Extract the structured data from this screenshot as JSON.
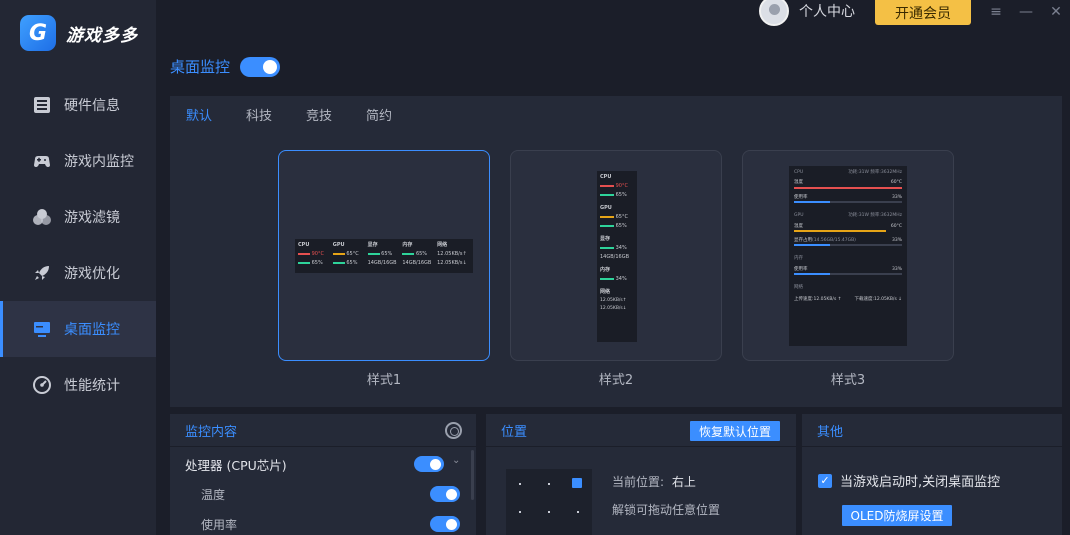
{
  "app": {
    "name": "游戏多多",
    "logo_letter": "G"
  },
  "topbar": {
    "user_label": "个人中心",
    "vip_button": "开通会员",
    "menu_icon": "≡",
    "min_icon": "—",
    "close_icon": "✕"
  },
  "sidebar": {
    "items": [
      {
        "label": "硬件信息",
        "icon": "hardware-icon"
      },
      {
        "label": "游戏内监控",
        "icon": "gamepad-icon"
      },
      {
        "label": "游戏滤镜",
        "icon": "filter-icon"
      },
      {
        "label": "游戏优化",
        "icon": "rocket-icon"
      },
      {
        "label": "桌面监控",
        "icon": "monitor-icon",
        "active": true
      },
      {
        "label": "性能统计",
        "icon": "gauge-icon"
      }
    ]
  },
  "desktop_monitor": {
    "title": "桌面监控",
    "enabled": true
  },
  "tabs": [
    "默认",
    "科技",
    "竞技",
    "简约"
  ],
  "active_tab": "默认",
  "styles": [
    {
      "label": "样式1",
      "selected": true
    },
    {
      "label": "样式2",
      "selected": false
    },
    {
      "label": "样式3",
      "selected": false
    }
  ],
  "preview1": {
    "cpu": "CPU",
    "gpu": "GPU",
    "vram": "显存",
    "mem": "内存",
    "net": "网络",
    "cpu_temp": "90°C",
    "gpu_temp": "65°C",
    "vram_pct": "65%",
    "mem_pct": "65%",
    "net_up": "12.05KB/s↑",
    "cpu_use": "65%",
    "gpu_use": "65%",
    "vram_size": "14GB/16GB",
    "mem_size": "14GB/16GB",
    "net_down": "12.05KB/s↓"
  },
  "preview2": {
    "cpu": "CPU",
    "cpu_temp": "90°C",
    "cpu_use": "65%",
    "gpu": "GPU",
    "gpu_temp": "65°C",
    "gpu_use": "65%",
    "vram": "显存",
    "vram_pct": "34%",
    "vram_size": "14GB/16GB",
    "mem": "内存",
    "mem_pct": "34%",
    "net": "网络",
    "net_up": "12.05KB/s↑",
    "net_down": "12.05KB/s↓"
  },
  "preview3": {
    "cpu": "CPU",
    "cpu_info": "功耗:31W   频率:3632MHz",
    "temp_label": "温度",
    "cpu_temp": "60°C",
    "use_label": "使用率",
    "cpu_use": "33%",
    "gpu": "GPU",
    "gpu_info": "功耗:31W   频率:3632MHz",
    "gpu_temp": "60°C",
    "vram_label": "显存占用",
    "vram_size": "(14.56GB/15.47GB)",
    "vram_use": "33%",
    "mem": "内存",
    "mem_use": "33%",
    "net": "网络",
    "net_up": "上传速度:12.05KB/s ↑",
    "net_down": "下载速度:12.05KB/s ↓"
  },
  "monitor_content": {
    "title": "监控内容",
    "group": "处理器 (CPU芯片)",
    "items": [
      "温度",
      "使用率"
    ]
  },
  "position": {
    "title": "位置",
    "reset_button": "恢复默认位置",
    "current_label": "当前位置:",
    "current_value": "右上",
    "hint": "解锁可拖动任意位置"
  },
  "other": {
    "title": "其他",
    "checkbox_label": "当游戏启动时,关闭桌面监控",
    "checked": true,
    "oled_button": "OLED防烧屏设置"
  },
  "colors": {
    "accent": "#3b8eff",
    "vip": "#f4c045",
    "cpu_bar": "#e65050",
    "gpu_bar": "#e6a417",
    "green_bar": "#2ed39a"
  }
}
